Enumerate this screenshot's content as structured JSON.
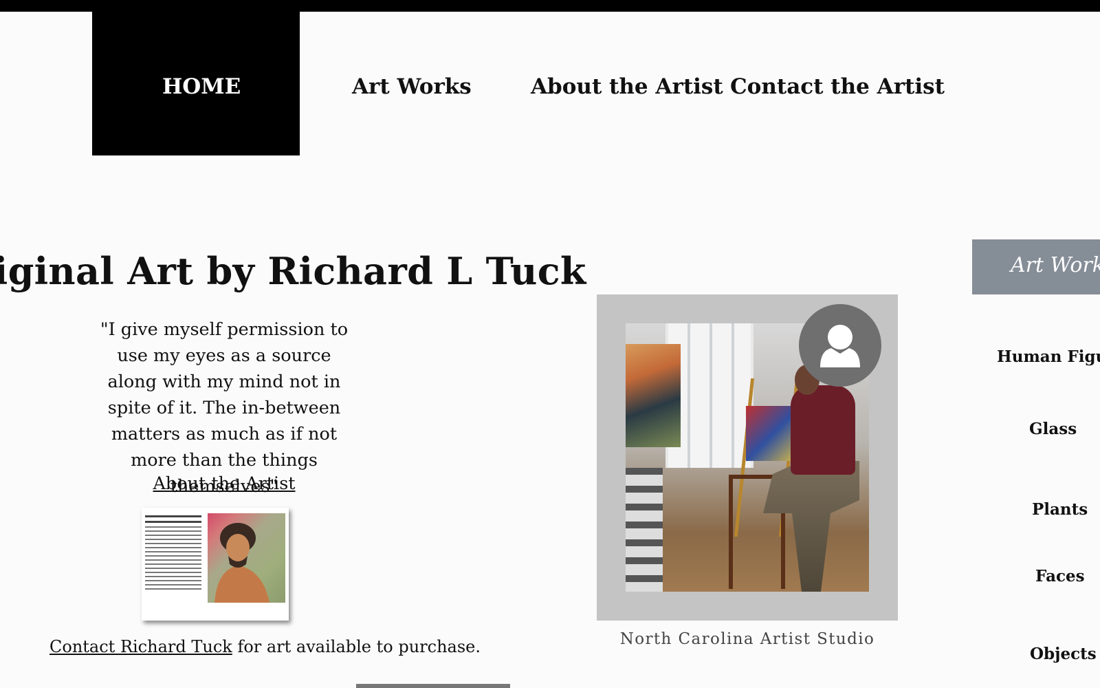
{
  "nav": {
    "home": "HOME",
    "art_works": "Art Works",
    "about": "About the Artist",
    "contact": "Contact the Artist"
  },
  "main": {
    "title": "riginal Art by Richard L Tuck",
    "quote": "\"I give myself permission to use my eyes as a source along with my mind not in spite of it. The in-between matters as much as if not more than the things themselves\"",
    "about_link": "About the Artist",
    "contact_link": "Contact Richard Tuck",
    "contact_suffix": " for art available to purchase.",
    "photo_caption": "North Carolina Artist Studio"
  },
  "sidebar": {
    "header": "Art Works",
    "items": [
      "Human Figur",
      "Glass",
      "Plants",
      "Faces",
      "Objects"
    ]
  },
  "colors": {
    "nav_active_bg": "#000000",
    "sidebar_header_bg": "#858d97",
    "photo_frame_bg": "#c4c4c4",
    "avatar_bg": "#6f6f6f"
  }
}
